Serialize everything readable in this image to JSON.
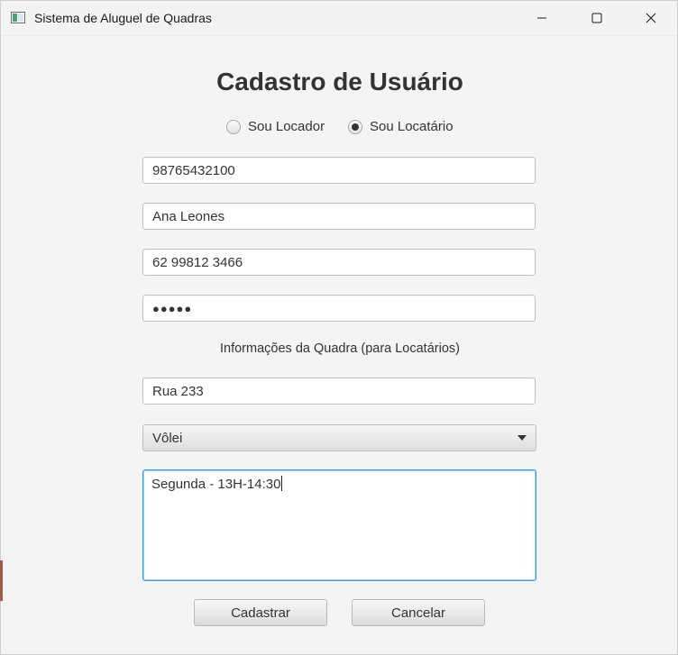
{
  "window": {
    "title": "Sistema de Aluguel de Quadras"
  },
  "form": {
    "heading": "Cadastro de Usuário",
    "radios": [
      {
        "label": "Sou Locador",
        "selected": false
      },
      {
        "label": "Sou Locatário",
        "selected": true
      }
    ],
    "fields": {
      "document": "98765432100",
      "name": "Ana Leones",
      "phone": "62 99812 3466",
      "password_masked": "●●●●●"
    },
    "section_label": "Informações da Quadra (para Locatários)",
    "court": {
      "address": "Rua 233",
      "sport_selected": "Vôlei",
      "schedule_text": "Segunda - 13H-14:30"
    },
    "buttons": {
      "submit": "Cadastrar",
      "cancel": "Cancelar"
    }
  },
  "colors": {
    "background": "#f4f4f4",
    "focus_border": "#2ea1db",
    "text": "#333333"
  },
  "icons": {
    "app": "window-app-icon",
    "minimize": "minimize-icon",
    "maximize": "maximize-icon",
    "close": "close-icon",
    "dropdown": "chevron-down-icon"
  }
}
